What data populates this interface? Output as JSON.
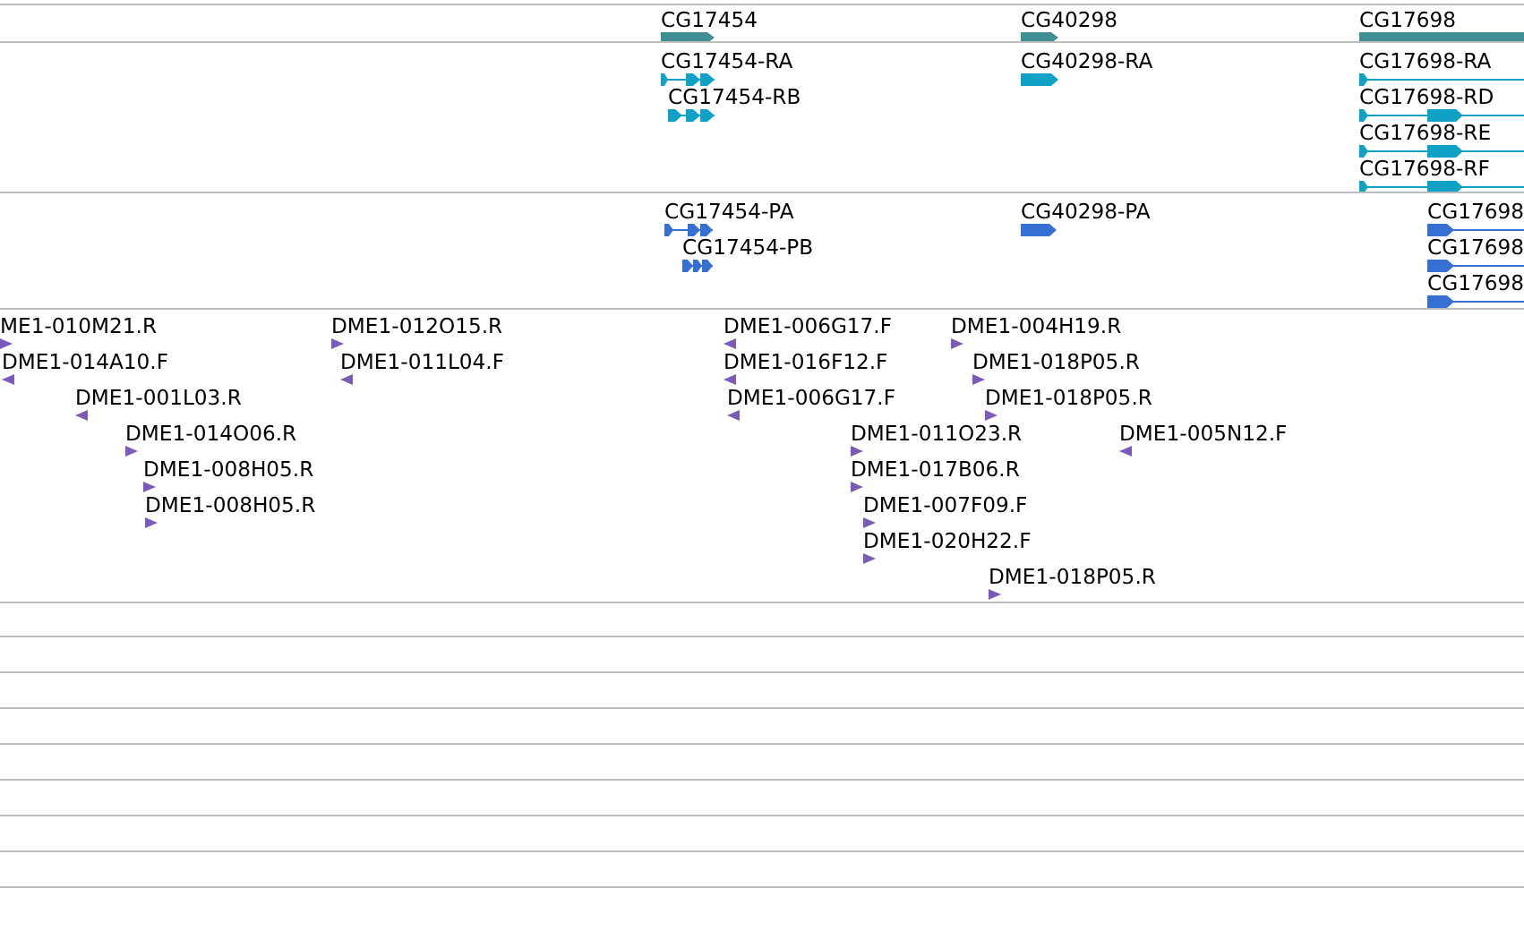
{
  "tracks": [
    {
      "kind": "gene",
      "features": [
        {
          "label": "CG17454",
          "forward": true
        },
        {
          "label": "CG40298",
          "forward": true
        },
        {
          "label": "CG17698"
        }
      ]
    },
    {
      "kind": "transcript",
      "features": [
        {
          "label": "CG17454-RA",
          "forward": true
        },
        {
          "label": "CG17454-RB",
          "forward": true
        },
        {
          "label": "CG40298-RA",
          "forward": true
        },
        {
          "label": "CG17698-RA",
          "forward": true
        },
        {
          "label": "CG17698-RD",
          "forward": true
        },
        {
          "label": "CG17698-RE",
          "forward": true
        },
        {
          "label": "CG17698-RF",
          "forward": true
        }
      ]
    },
    {
      "kind": "protein",
      "features": [
        {
          "label": "CG17454-PA",
          "forward": true
        },
        {
          "label": "CG17454-PB",
          "forward": true
        },
        {
          "label": "CG40298-PA",
          "forward": true
        },
        {
          "label": "CG17698",
          "forward": true
        },
        {
          "label": "CG17698",
          "forward": true
        },
        {
          "label": "CG17698",
          "forward": true
        }
      ]
    },
    {
      "kind": "clone",
      "features": [
        {
          "label": "ME1-010M21.R",
          "forward": true
        },
        {
          "label": "DME1-014A10.F",
          "forward": false
        },
        {
          "label": "DME1-001L03.R",
          "forward": false
        },
        {
          "label": "DME1-014O06.R",
          "forward": true
        },
        {
          "label": "DME1-008H05.R",
          "forward": true
        },
        {
          "label": "DME1-008H05.R",
          "forward": true
        },
        {
          "label": "DME1-012O15.R",
          "forward": true
        },
        {
          "label": "DME1-011L04.F",
          "forward": false
        },
        {
          "label": "DME1-006G17.F",
          "forward": false
        },
        {
          "label": "DME1-016F12.F",
          "forward": false
        },
        {
          "label": "DME1-006G17.F",
          "forward": false
        },
        {
          "label": "DME1-004H19.R",
          "forward": true
        },
        {
          "label": "DME1-018P05.R",
          "forward": true
        },
        {
          "label": "DME1-018P05.R",
          "forward": true
        },
        {
          "label": "DME1-011O23.R",
          "forward": true
        },
        {
          "label": "DME1-005N12.F",
          "forward": false
        },
        {
          "label": "DME1-017B06.R",
          "forward": true
        },
        {
          "label": "DME1-007F09.F",
          "forward": true
        },
        {
          "label": "DME1-020H22.F",
          "forward": true
        },
        {
          "label": "DME1-018P05.R",
          "forward": true
        }
      ]
    }
  ]
}
